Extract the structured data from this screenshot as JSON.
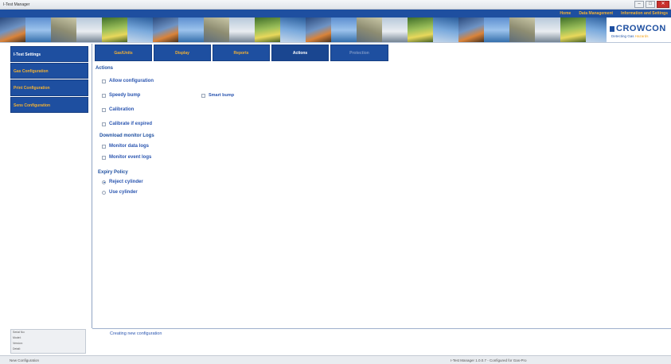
{
  "window": {
    "title": "I-Test Manager",
    "buttons": {
      "minimize": "–",
      "maximize": "□",
      "close": "✕"
    }
  },
  "menu": {
    "items": [
      "Home",
      "Data Management",
      "Information and Settings"
    ]
  },
  "logo": {
    "name": "CROWCON",
    "tagline_prefix": "Detecting Gas ",
    "tagline_highlight": "Hazards"
  },
  "sidebar": {
    "items": [
      {
        "label": "I-Test Settings"
      },
      {
        "label": "Gas Configuration"
      },
      {
        "label": "Print Configuration"
      },
      {
        "label": "Sens Configuration"
      }
    ]
  },
  "tabs": [
    {
      "label": "Gas/Units",
      "state": "normal"
    },
    {
      "label": "Display",
      "state": "normal"
    },
    {
      "label": "Reports",
      "state": "normal"
    },
    {
      "label": "Actions",
      "state": "active"
    },
    {
      "label": "Protection",
      "state": "disabled"
    }
  ],
  "actions": {
    "title": "Actions",
    "allow_configuration": "Allow configuration",
    "speedy_bump": "Speedy bump",
    "smart_bump": "Smart bump",
    "calibration": "Calibration",
    "calibrate_if_expired": "Calibrate if expired"
  },
  "download": {
    "title": "Download monitor Logs",
    "data_logs": "Monitor data logs",
    "event_logs": "Monitor event logs"
  },
  "expiry": {
    "title": "Expiry Policy",
    "reject": "Reject cylinder",
    "use": "Use cylinder",
    "selected": "reject"
  },
  "info_panel": {
    "lines": [
      "Serial No:",
      "Model:",
      "Version:",
      "Detail:"
    ]
  },
  "status_message": "Creating new configuration",
  "statusbar": {
    "left": "New Configuration",
    "right": "I-Test Manager 1.0.0.7 - Configured for Gas-Pro"
  },
  "colors": {
    "brand_blue": "#1e4fa0",
    "accent_orange": "#f2b134"
  }
}
